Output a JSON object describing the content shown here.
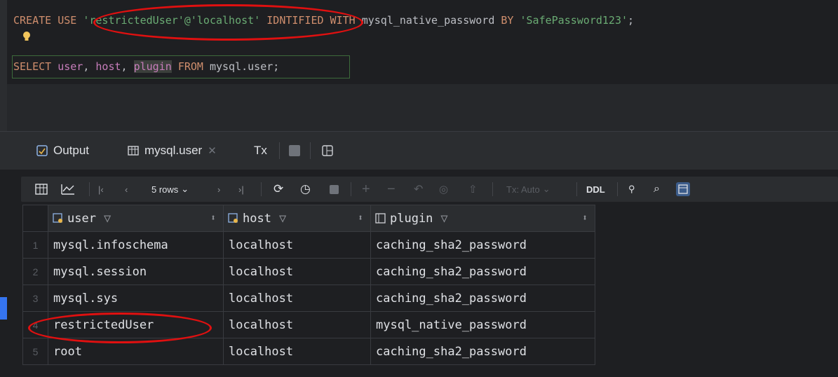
{
  "editor": {
    "line1": {
      "kw1": "CREATE USE",
      "user_literal": "'restrictedUser'@'localhost'",
      "kw2": "ID",
      "kw2_rest": "NTIFIED WITH",
      "plugin": "mysql_native_password",
      "kw3": "BY",
      "password": "'SafePassword123'",
      "end": ";"
    },
    "line2": {
      "select": "SELECT",
      "cols_user": "user",
      "comma1": ", ",
      "cols_host": "host",
      "comma2": ", ",
      "cols_plugin": "plugin",
      "from": "FROM",
      "table": "mysql.user",
      "end": ";"
    }
  },
  "panel": {
    "tabs": [
      {
        "label": "Output",
        "icon": "output-icon"
      },
      {
        "label": "mysql.user",
        "icon": "table-icon"
      },
      {
        "label": "Tx",
        "icon": "tx-icon"
      }
    ],
    "toolbar": {
      "rows_label": "5 rows",
      "tx_label": "Tx: Auto",
      "ddl_label": "DDL"
    },
    "columns": [
      {
        "name": "user",
        "icon": "key-column-icon"
      },
      {
        "name": "host",
        "icon": "key-column-icon"
      },
      {
        "name": "plugin",
        "icon": "column-icon"
      }
    ],
    "rows": [
      {
        "num": "1",
        "user": "mysql.infoschema",
        "host": "localhost",
        "plugin": "caching_sha2_password"
      },
      {
        "num": "2",
        "user": "mysql.session",
        "host": "localhost",
        "plugin": "caching_sha2_password"
      },
      {
        "num": "3",
        "user": "mysql.sys",
        "host": "localhost",
        "plugin": "caching_sha2_password"
      },
      {
        "num": "4",
        "user": "restrictedUser",
        "host": "localhost",
        "plugin": "mysql_native_password"
      },
      {
        "num": "5",
        "user": "root",
        "host": "localhost",
        "plugin": "caching_sha2_password"
      }
    ]
  },
  "colors": {
    "annotation": "#e01010",
    "keyword": "#cf8e6d",
    "string": "#6aab73",
    "identifier": "#c77dbb"
  }
}
